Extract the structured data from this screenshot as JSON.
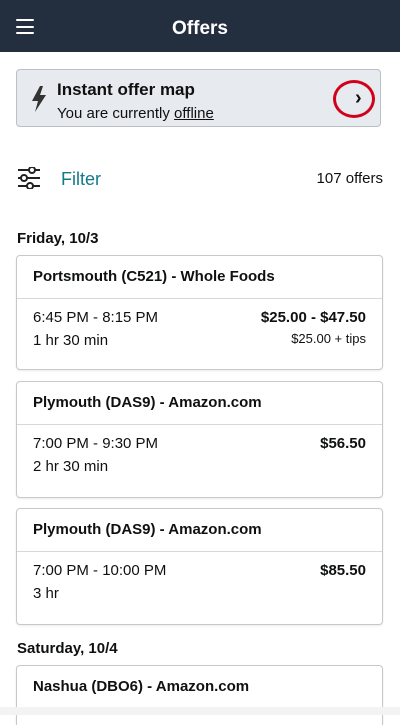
{
  "header": {
    "title": "Offers",
    "menu_icon": "hamburger-menu-icon"
  },
  "offer_map": {
    "title": "Instant offer map",
    "status_prefix": "You are currently",
    "status_link": "offline",
    "icon": "lightning-bolt-icon",
    "action_icon": "chevron-right-icon",
    "highlight_color": "#d0021b"
  },
  "filter": {
    "label": "Filter",
    "icon": "filter-sliders-icon",
    "count": "107 offers"
  },
  "colors": {
    "header_bg": "#232f3e",
    "accent": "#127a8a"
  },
  "days": [
    {
      "date": "Friday, 10/3",
      "offers": [
        {
          "title": "Portsmouth (C521) - Whole Foods",
          "time": "6:45 PM - 8:15 PM",
          "duration": "1 hr 30 min",
          "pay": "$25.00 - $47.50",
          "tips": "$25.00 + tips"
        },
        {
          "title": "Plymouth (DAS9) - Amazon.com",
          "time": "7:00 PM - 9:30 PM",
          "duration": "2 hr 30 min",
          "pay": "$56.50",
          "tips": ""
        },
        {
          "title": "Plymouth (DAS9) - Amazon.com",
          "time": "7:00 PM - 10:00 PM",
          "duration": "3 hr",
          "pay": "$85.50",
          "tips": ""
        }
      ]
    },
    {
      "date": "Saturday, 10/4",
      "offers": [
        {
          "title": "Nashua (DBO6) - Amazon.com"
        }
      ]
    }
  ]
}
